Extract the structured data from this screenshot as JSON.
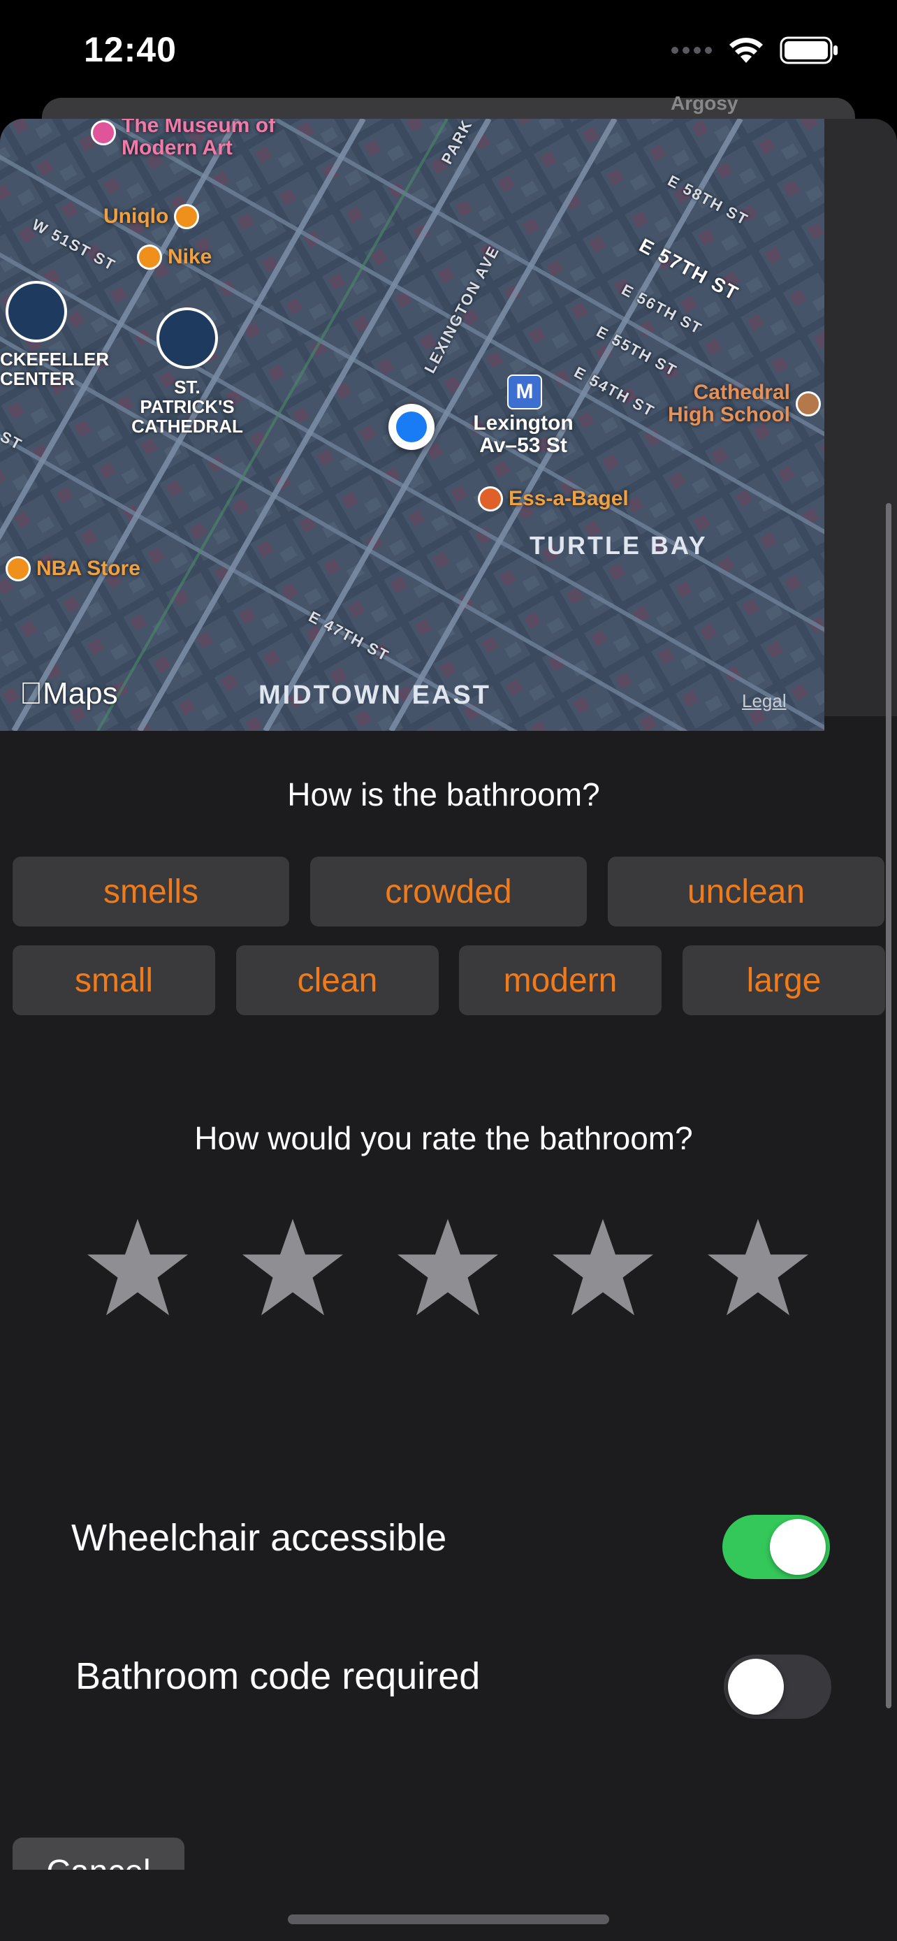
{
  "status_bar": {
    "time": "12:40",
    "icons": [
      "cellular-icon",
      "wifi-icon",
      "battery-icon"
    ]
  },
  "map": {
    "top_partial_label": "Argosy",
    "streets": [
      "PARK",
      "LEXINGTON AVE",
      "W 51ST ST",
      "E 58TH ST",
      "E 57TH ST",
      "E 56TH ST",
      "E 55TH ST",
      "E 54TH ST",
      "E 47TH ST",
      "ST"
    ],
    "pois": {
      "museum": "The Museum of Modern Art",
      "museum_line1": "The Museum of",
      "museum_line2": "Modern Art",
      "uniqlo": "Uniqlo",
      "nike": "Nike",
      "cathedral_school_line1": "Cathedral",
      "cathedral_school_line2": "High School",
      "ess_a_bagel": "Ess-a-Bagel",
      "nba_store": "NBA Store",
      "lexington_station_line1": "Lexington",
      "lexington_station_line2": "Av–53 St",
      "rockefeller_line1": "CKEFELLER",
      "rockefeller_line2": "CENTER",
      "st_patricks_line1": "ST.",
      "st_patricks_line2": "PATRICK'S",
      "st_patricks_line3": "CATHEDRAL",
      "metro_letter": "M"
    },
    "districts": {
      "turtle_bay": "TURTLE BAY",
      "midtown_east": "MIDTOWN EAST"
    },
    "brand": "Maps",
    "legal": "Legal"
  },
  "feedback": {
    "question": "How is the bathroom?",
    "tags_row1": [
      "smells",
      "crowded",
      "unclean"
    ],
    "tags_row2": [
      "small",
      "clean",
      "modern",
      "large"
    ]
  },
  "rating": {
    "question": "How would you rate the bathroom?",
    "max_stars": 5,
    "selected_stars": 0
  },
  "toggles": {
    "wheelchair": {
      "label": "Wheelchair accessible",
      "on": true
    },
    "code_required": {
      "label": "Bathroom code required",
      "on": false
    }
  },
  "footer": {
    "cancel_label": "Cancel"
  },
  "colors": {
    "accent": "#f07b1a",
    "toggle_on": "#34c759",
    "toggle_off": "#39393d",
    "star_empty": "#8e8e93",
    "sheet_bg": "#1c1c1e",
    "tag_bg": "#3a3a3c"
  }
}
